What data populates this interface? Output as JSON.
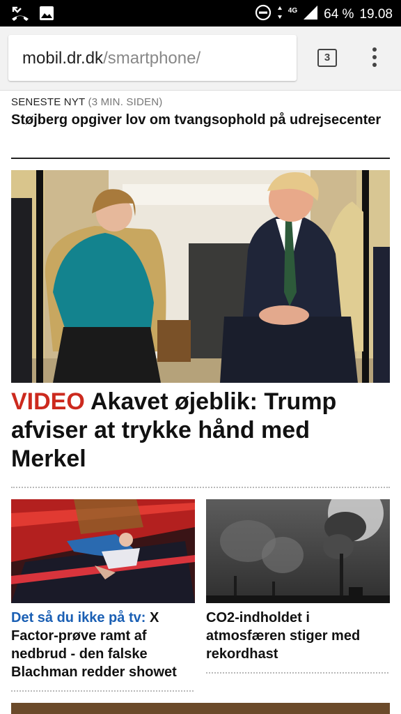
{
  "status_bar": {
    "left_icons": [
      "missed-call-icon",
      "image-icon"
    ],
    "right_icons": [
      "do-not-disturb-icon",
      "data-arrows-icon",
      "signal-4g-icon"
    ],
    "network": "4G",
    "battery": "64 %",
    "time": "19.08"
  },
  "browser": {
    "url_domain": "mobil.dr.dk",
    "url_path": "/smartphone/",
    "tab_count": "3"
  },
  "latest": {
    "label": "SENESTE NYT",
    "time": "(3 MIN. SIDEN)",
    "headline": "Støjberg opgiver lov om tvangsophold på udrejsecenter"
  },
  "hero": {
    "tag": "VIDEO",
    "headline": "Akavet øjeblik: Trump afviser at trykke hånd med Merkel"
  },
  "cards": [
    {
      "kicker": "Det så du ikke på tv:",
      "headline": "X Factor-prøve ramt af nedbrud - den falske Blachman redder showet"
    },
    {
      "kicker": "",
      "headline": "CO2-indholdet i atmosfæren stiger med rekordhast"
    }
  ]
}
